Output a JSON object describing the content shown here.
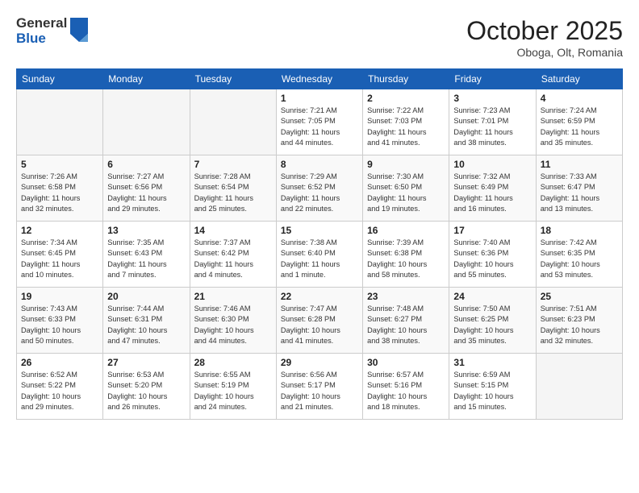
{
  "header": {
    "logo_general": "General",
    "logo_blue": "Blue",
    "month_title": "October 2025",
    "location": "Oboga, Olt, Romania"
  },
  "days_of_week": [
    "Sunday",
    "Monday",
    "Tuesday",
    "Wednesday",
    "Thursday",
    "Friday",
    "Saturday"
  ],
  "weeks": [
    [
      {
        "day": "",
        "info": ""
      },
      {
        "day": "",
        "info": ""
      },
      {
        "day": "",
        "info": ""
      },
      {
        "day": "1",
        "info": "Sunrise: 7:21 AM\nSunset: 7:05 PM\nDaylight: 11 hours\nand 44 minutes."
      },
      {
        "day": "2",
        "info": "Sunrise: 7:22 AM\nSunset: 7:03 PM\nDaylight: 11 hours\nand 41 minutes."
      },
      {
        "day": "3",
        "info": "Sunrise: 7:23 AM\nSunset: 7:01 PM\nDaylight: 11 hours\nand 38 minutes."
      },
      {
        "day": "4",
        "info": "Sunrise: 7:24 AM\nSunset: 6:59 PM\nDaylight: 11 hours\nand 35 minutes."
      }
    ],
    [
      {
        "day": "5",
        "info": "Sunrise: 7:26 AM\nSunset: 6:58 PM\nDaylight: 11 hours\nand 32 minutes."
      },
      {
        "day": "6",
        "info": "Sunrise: 7:27 AM\nSunset: 6:56 PM\nDaylight: 11 hours\nand 29 minutes."
      },
      {
        "day": "7",
        "info": "Sunrise: 7:28 AM\nSunset: 6:54 PM\nDaylight: 11 hours\nand 25 minutes."
      },
      {
        "day": "8",
        "info": "Sunrise: 7:29 AM\nSunset: 6:52 PM\nDaylight: 11 hours\nand 22 minutes."
      },
      {
        "day": "9",
        "info": "Sunrise: 7:30 AM\nSunset: 6:50 PM\nDaylight: 11 hours\nand 19 minutes."
      },
      {
        "day": "10",
        "info": "Sunrise: 7:32 AM\nSunset: 6:49 PM\nDaylight: 11 hours\nand 16 minutes."
      },
      {
        "day": "11",
        "info": "Sunrise: 7:33 AM\nSunset: 6:47 PM\nDaylight: 11 hours\nand 13 minutes."
      }
    ],
    [
      {
        "day": "12",
        "info": "Sunrise: 7:34 AM\nSunset: 6:45 PM\nDaylight: 11 hours\nand 10 minutes."
      },
      {
        "day": "13",
        "info": "Sunrise: 7:35 AM\nSunset: 6:43 PM\nDaylight: 11 hours\nand 7 minutes."
      },
      {
        "day": "14",
        "info": "Sunrise: 7:37 AM\nSunset: 6:42 PM\nDaylight: 11 hours\nand 4 minutes."
      },
      {
        "day": "15",
        "info": "Sunrise: 7:38 AM\nSunset: 6:40 PM\nDaylight: 11 hours\nand 1 minute."
      },
      {
        "day": "16",
        "info": "Sunrise: 7:39 AM\nSunset: 6:38 PM\nDaylight: 10 hours\nand 58 minutes."
      },
      {
        "day": "17",
        "info": "Sunrise: 7:40 AM\nSunset: 6:36 PM\nDaylight: 10 hours\nand 55 minutes."
      },
      {
        "day": "18",
        "info": "Sunrise: 7:42 AM\nSunset: 6:35 PM\nDaylight: 10 hours\nand 53 minutes."
      }
    ],
    [
      {
        "day": "19",
        "info": "Sunrise: 7:43 AM\nSunset: 6:33 PM\nDaylight: 10 hours\nand 50 minutes."
      },
      {
        "day": "20",
        "info": "Sunrise: 7:44 AM\nSunset: 6:31 PM\nDaylight: 10 hours\nand 47 minutes."
      },
      {
        "day": "21",
        "info": "Sunrise: 7:46 AM\nSunset: 6:30 PM\nDaylight: 10 hours\nand 44 minutes."
      },
      {
        "day": "22",
        "info": "Sunrise: 7:47 AM\nSunset: 6:28 PM\nDaylight: 10 hours\nand 41 minutes."
      },
      {
        "day": "23",
        "info": "Sunrise: 7:48 AM\nSunset: 6:27 PM\nDaylight: 10 hours\nand 38 minutes."
      },
      {
        "day": "24",
        "info": "Sunrise: 7:50 AM\nSunset: 6:25 PM\nDaylight: 10 hours\nand 35 minutes."
      },
      {
        "day": "25",
        "info": "Sunrise: 7:51 AM\nSunset: 6:23 PM\nDaylight: 10 hours\nand 32 minutes."
      }
    ],
    [
      {
        "day": "26",
        "info": "Sunrise: 6:52 AM\nSunset: 5:22 PM\nDaylight: 10 hours\nand 29 minutes."
      },
      {
        "day": "27",
        "info": "Sunrise: 6:53 AM\nSunset: 5:20 PM\nDaylight: 10 hours\nand 26 minutes."
      },
      {
        "day": "28",
        "info": "Sunrise: 6:55 AM\nSunset: 5:19 PM\nDaylight: 10 hours\nand 24 minutes."
      },
      {
        "day": "29",
        "info": "Sunrise: 6:56 AM\nSunset: 5:17 PM\nDaylight: 10 hours\nand 21 minutes."
      },
      {
        "day": "30",
        "info": "Sunrise: 6:57 AM\nSunset: 5:16 PM\nDaylight: 10 hours\nand 18 minutes."
      },
      {
        "day": "31",
        "info": "Sunrise: 6:59 AM\nSunset: 5:15 PM\nDaylight: 10 hours\nand 15 minutes."
      },
      {
        "day": "",
        "info": ""
      }
    ]
  ]
}
